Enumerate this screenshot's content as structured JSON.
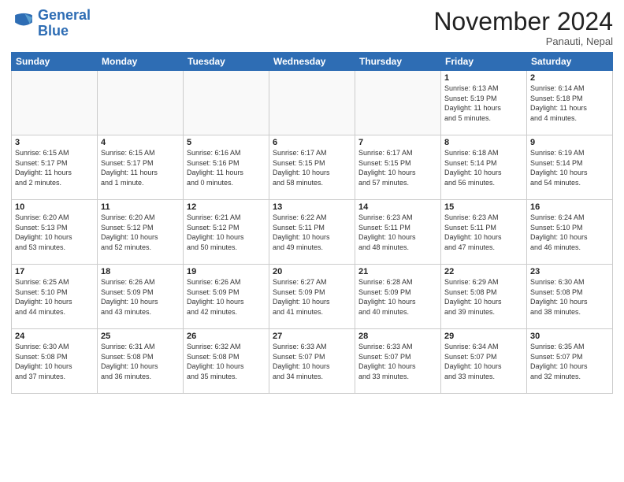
{
  "header": {
    "logo_line1": "General",
    "logo_line2": "Blue",
    "month_title": "November 2024",
    "location": "Panauti, Nepal"
  },
  "weekdays": [
    "Sunday",
    "Monday",
    "Tuesday",
    "Wednesday",
    "Thursday",
    "Friday",
    "Saturday"
  ],
  "weeks": [
    [
      {
        "day": "",
        "info": ""
      },
      {
        "day": "",
        "info": ""
      },
      {
        "day": "",
        "info": ""
      },
      {
        "day": "",
        "info": ""
      },
      {
        "day": "",
        "info": ""
      },
      {
        "day": "1",
        "info": "Sunrise: 6:13 AM\nSunset: 5:19 PM\nDaylight: 11 hours\nand 5 minutes."
      },
      {
        "day": "2",
        "info": "Sunrise: 6:14 AM\nSunset: 5:18 PM\nDaylight: 11 hours\nand 4 minutes."
      }
    ],
    [
      {
        "day": "3",
        "info": "Sunrise: 6:15 AM\nSunset: 5:17 PM\nDaylight: 11 hours\nand 2 minutes."
      },
      {
        "day": "4",
        "info": "Sunrise: 6:15 AM\nSunset: 5:17 PM\nDaylight: 11 hours\nand 1 minute."
      },
      {
        "day": "5",
        "info": "Sunrise: 6:16 AM\nSunset: 5:16 PM\nDaylight: 11 hours\nand 0 minutes."
      },
      {
        "day": "6",
        "info": "Sunrise: 6:17 AM\nSunset: 5:15 PM\nDaylight: 10 hours\nand 58 minutes."
      },
      {
        "day": "7",
        "info": "Sunrise: 6:17 AM\nSunset: 5:15 PM\nDaylight: 10 hours\nand 57 minutes."
      },
      {
        "day": "8",
        "info": "Sunrise: 6:18 AM\nSunset: 5:14 PM\nDaylight: 10 hours\nand 56 minutes."
      },
      {
        "day": "9",
        "info": "Sunrise: 6:19 AM\nSunset: 5:14 PM\nDaylight: 10 hours\nand 54 minutes."
      }
    ],
    [
      {
        "day": "10",
        "info": "Sunrise: 6:20 AM\nSunset: 5:13 PM\nDaylight: 10 hours\nand 53 minutes."
      },
      {
        "day": "11",
        "info": "Sunrise: 6:20 AM\nSunset: 5:12 PM\nDaylight: 10 hours\nand 52 minutes."
      },
      {
        "day": "12",
        "info": "Sunrise: 6:21 AM\nSunset: 5:12 PM\nDaylight: 10 hours\nand 50 minutes."
      },
      {
        "day": "13",
        "info": "Sunrise: 6:22 AM\nSunset: 5:11 PM\nDaylight: 10 hours\nand 49 minutes."
      },
      {
        "day": "14",
        "info": "Sunrise: 6:23 AM\nSunset: 5:11 PM\nDaylight: 10 hours\nand 48 minutes."
      },
      {
        "day": "15",
        "info": "Sunrise: 6:23 AM\nSunset: 5:11 PM\nDaylight: 10 hours\nand 47 minutes."
      },
      {
        "day": "16",
        "info": "Sunrise: 6:24 AM\nSunset: 5:10 PM\nDaylight: 10 hours\nand 46 minutes."
      }
    ],
    [
      {
        "day": "17",
        "info": "Sunrise: 6:25 AM\nSunset: 5:10 PM\nDaylight: 10 hours\nand 44 minutes."
      },
      {
        "day": "18",
        "info": "Sunrise: 6:26 AM\nSunset: 5:09 PM\nDaylight: 10 hours\nand 43 minutes."
      },
      {
        "day": "19",
        "info": "Sunrise: 6:26 AM\nSunset: 5:09 PM\nDaylight: 10 hours\nand 42 minutes."
      },
      {
        "day": "20",
        "info": "Sunrise: 6:27 AM\nSunset: 5:09 PM\nDaylight: 10 hours\nand 41 minutes."
      },
      {
        "day": "21",
        "info": "Sunrise: 6:28 AM\nSunset: 5:09 PM\nDaylight: 10 hours\nand 40 minutes."
      },
      {
        "day": "22",
        "info": "Sunrise: 6:29 AM\nSunset: 5:08 PM\nDaylight: 10 hours\nand 39 minutes."
      },
      {
        "day": "23",
        "info": "Sunrise: 6:30 AM\nSunset: 5:08 PM\nDaylight: 10 hours\nand 38 minutes."
      }
    ],
    [
      {
        "day": "24",
        "info": "Sunrise: 6:30 AM\nSunset: 5:08 PM\nDaylight: 10 hours\nand 37 minutes."
      },
      {
        "day": "25",
        "info": "Sunrise: 6:31 AM\nSunset: 5:08 PM\nDaylight: 10 hours\nand 36 minutes."
      },
      {
        "day": "26",
        "info": "Sunrise: 6:32 AM\nSunset: 5:08 PM\nDaylight: 10 hours\nand 35 minutes."
      },
      {
        "day": "27",
        "info": "Sunrise: 6:33 AM\nSunset: 5:07 PM\nDaylight: 10 hours\nand 34 minutes."
      },
      {
        "day": "28",
        "info": "Sunrise: 6:33 AM\nSunset: 5:07 PM\nDaylight: 10 hours\nand 33 minutes."
      },
      {
        "day": "29",
        "info": "Sunrise: 6:34 AM\nSunset: 5:07 PM\nDaylight: 10 hours\nand 33 minutes."
      },
      {
        "day": "30",
        "info": "Sunrise: 6:35 AM\nSunset: 5:07 PM\nDaylight: 10 hours\nand 32 minutes."
      }
    ]
  ]
}
